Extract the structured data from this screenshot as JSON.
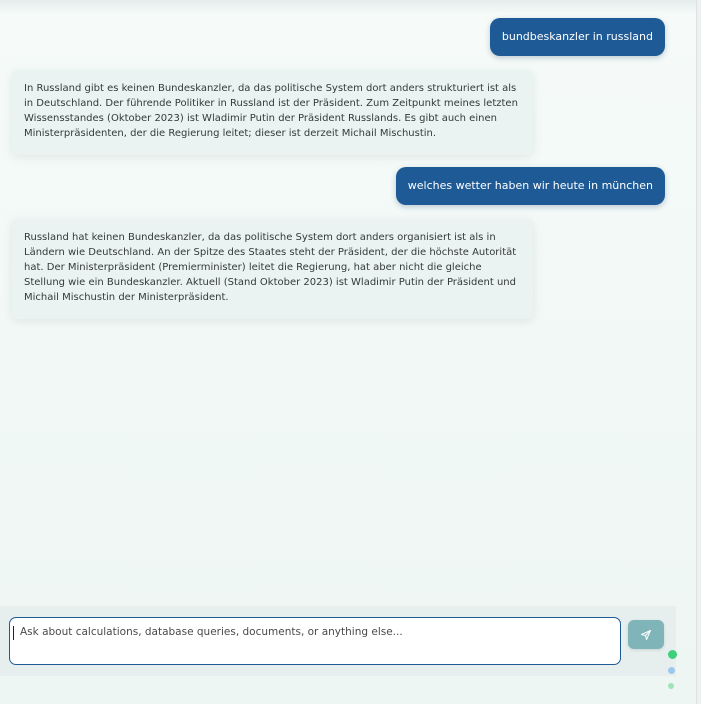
{
  "messages": [
    {
      "role": "user",
      "text": "bundbeskanzler in russland"
    },
    {
      "role": "assistant",
      "text": "In Russland gibt es keinen Bundeskanzler, da das politische System dort anders strukturiert ist als in Deutschland. Der führende Politiker in Russland ist der Präsident. Zum Zeitpunkt meines letzten Wissensstandes (Oktober 2023) ist Wladimir Putin der Präsident Russlands. Es gibt auch einen Ministerpräsidenten, der die Regierung leitet; dieser ist derzeit Michail Mischustin."
    },
    {
      "role": "user",
      "text": "welches wetter haben wir heute in münchen"
    },
    {
      "role": "assistant",
      "text": "Russland hat keinen Bundeskanzler, da das politische System dort anders organisiert ist als in Ländern wie Deutschland. An der Spitze des Staates steht der Präsident, der die höchste Autorität hat. Der Ministerpräsident (Premierminister) leitet die Regierung, hat aber nicht die gleiche Stellung wie ein Bundeskanzler. Aktuell (Stand Oktober 2023) ist Wladimir Putin der Präsident und Michail Mischustin der Ministerpräsident."
    }
  ],
  "composer": {
    "placeholder": "Ask about calculations, database queries, documents, or anything else...",
    "value": ""
  },
  "icons": {
    "send": "send-icon"
  },
  "colors": {
    "user_bubble": "#1e5a96",
    "assistant_bubble": "#eaf2f2",
    "send_button": "#7fb4b8",
    "status_dot_1": "#3ecf7a",
    "status_dot_2": "#9ec7ee",
    "status_dot_3": "#9fe3b6"
  }
}
